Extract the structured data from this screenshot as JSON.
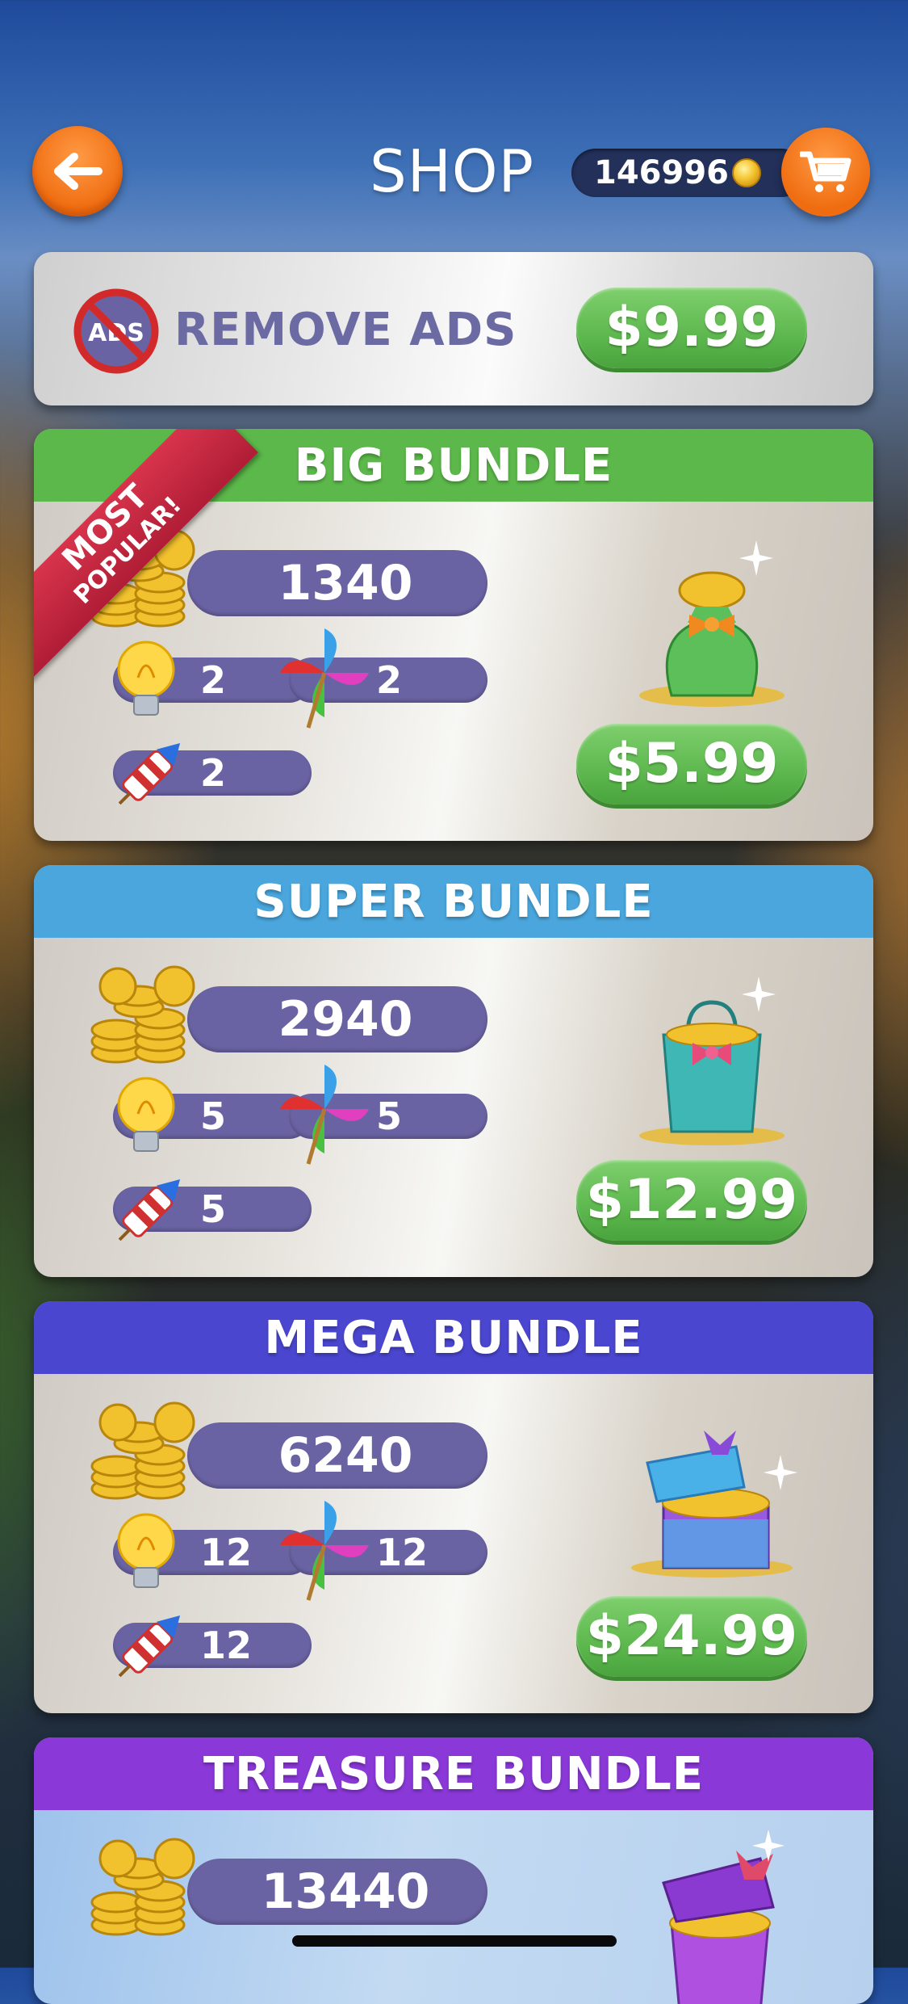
{
  "header": {
    "title": "SHOP",
    "coin_balance": "146996",
    "back_icon": "arrow-left-icon",
    "cart_icon": "cart-icon"
  },
  "remove_ads": {
    "icon": "no-ads-icon",
    "icon_text": "ADS",
    "label": "REMOVE ADS",
    "price": "$9.99"
  },
  "bundles": [
    {
      "title": "BIG BUNDLE",
      "header_color": "#5cb84a",
      "ribbon": {
        "line1": "MOST",
        "line2": "POPULAR!"
      },
      "coins": "1340",
      "hints": "2",
      "pinwheels": "2",
      "rockets": "2",
      "prize_icon": "coin-sack-icon",
      "price": "$5.99"
    },
    {
      "title": "SUPER BUNDLE",
      "header_color": "#4aa6dc",
      "coins": "2940",
      "hints": "5",
      "pinwheels": "5",
      "rockets": "5",
      "prize_icon": "gift-bag-icon",
      "price": "$12.99"
    },
    {
      "title": "MEGA BUNDLE",
      "header_color": "#4a46d0",
      "coins": "6240",
      "hints": "12",
      "pinwheels": "12",
      "rockets": "12",
      "prize_icon": "treasure-box-icon",
      "price": "$24.99"
    },
    {
      "title": "TREASURE BUNDLE",
      "header_color": "#8a38d8",
      "coins": "13440",
      "prize_icon": "treasure-chest-icon"
    }
  ],
  "colors": {
    "accent_orange": "#ef6c10",
    "price_green": "#5db84e",
    "pill_purple": "#6a63a3"
  }
}
